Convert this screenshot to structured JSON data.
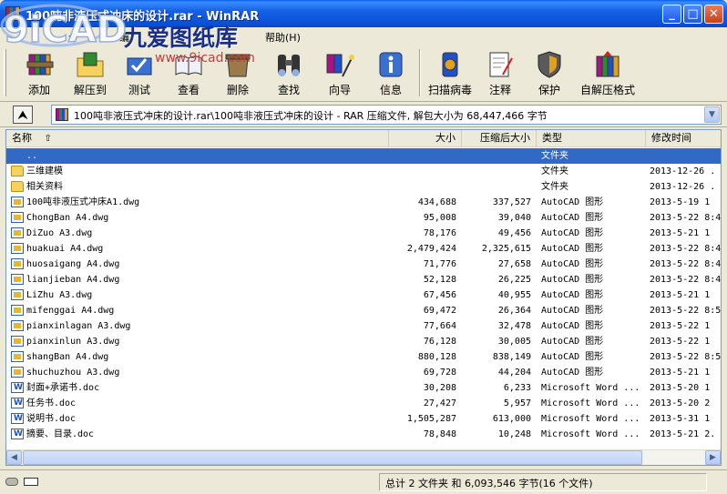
{
  "window": {
    "title": "100吨非液压式冲床的设计.rar - WinRAR",
    "minimize": "_",
    "maximize": "□",
    "close": "✕"
  },
  "menu": {
    "items": [
      "文件(F)",
      "命令(C)",
      "工具(S)",
      "收藏夹(O)",
      "选项(N)",
      "帮助(H)"
    ],
    "visible_items": [
      "令",
      "编",
      "帮助(H)"
    ]
  },
  "toolbar": {
    "buttons": [
      {
        "label": "添加",
        "icon": "add-books-icon"
      },
      {
        "label": "解压到",
        "icon": "extract-folder-icon"
      },
      {
        "label": "测试",
        "icon": "test-icon"
      },
      {
        "label": "查看",
        "icon": "view-book-icon"
      },
      {
        "label": "删除",
        "icon": "delete-icon"
      },
      {
        "label": "查找",
        "icon": "binoculars-icon"
      },
      {
        "label": "向导",
        "icon": "wizard-icon"
      },
      {
        "label": "信息",
        "icon": "info-icon"
      },
      {
        "label": "扫描病毒",
        "icon": "virus-scan-icon"
      },
      {
        "label": "注释",
        "icon": "comment-icon"
      },
      {
        "label": "保护",
        "icon": "shield-icon"
      },
      {
        "label": "自解压格式",
        "icon": "sfx-icon"
      }
    ]
  },
  "address": {
    "path": "100吨非液压式冲床的设计.rar\\100吨非液压式冲床的设计 - RAR 压缩文件, 解包大小为 68,447,466 字节"
  },
  "columns": {
    "name": "名称",
    "size": "大小",
    "packed": "压缩后大小",
    "type": "类型",
    "modified": "修改时间"
  },
  "files": [
    {
      "name": "..",
      "size": "",
      "packed": "",
      "type": "文件夹",
      "modified": "",
      "icon": "up-folder-icon",
      "selected": true
    },
    {
      "name": "三维建模",
      "size": "",
      "packed": "",
      "type": "文件夹",
      "modified": "2013-12-26 .",
      "icon": "folder-icon"
    },
    {
      "name": "相关资料",
      "size": "",
      "packed": "",
      "type": "文件夹",
      "modified": "2013-12-26 .",
      "icon": "folder-icon"
    },
    {
      "name": "100吨非液压式冲床A1.dwg",
      "size": "434,688",
      "packed": "337,527",
      "type": "AutoCAD 图形",
      "modified": "2013-5-19 1",
      "icon": "dwg-file-icon"
    },
    {
      "name": "ChongBan   A4.dwg",
      "size": "95,008",
      "packed": "39,040",
      "type": "AutoCAD 图形",
      "modified": "2013-5-22 8:4",
      "icon": "dwg-file-icon"
    },
    {
      "name": "DiZuo  A3.dwg",
      "size": "78,176",
      "packed": "49,456",
      "type": "AutoCAD 图形",
      "modified": "2013-5-21 1",
      "icon": "dwg-file-icon"
    },
    {
      "name": "huakuai   A4.dwg",
      "size": "2,479,424",
      "packed": "2,325,615",
      "type": "AutoCAD 图形",
      "modified": "2013-5-22 8:4",
      "icon": "dwg-file-icon"
    },
    {
      "name": "huosaigang  A4.dwg",
      "size": "71,776",
      "packed": "27,658",
      "type": "AutoCAD 图形",
      "modified": "2013-5-22 8:4",
      "icon": "dwg-file-icon"
    },
    {
      "name": "lianjieban A4.dwg",
      "size": "52,128",
      "packed": "26,225",
      "type": "AutoCAD 图形",
      "modified": "2013-5-22 8:4",
      "icon": "dwg-file-icon"
    },
    {
      "name": "LiZhu  A3.dwg",
      "size": "67,456",
      "packed": "40,955",
      "type": "AutoCAD 图形",
      "modified": "2013-5-21 1",
      "icon": "dwg-file-icon"
    },
    {
      "name": "mifenggai A4.dwg",
      "size": "69,472",
      "packed": "26,364",
      "type": "AutoCAD 图形",
      "modified": "2013-5-22 8:5",
      "icon": "dwg-file-icon"
    },
    {
      "name": "pianxinlagan  A3.dwg",
      "size": "77,664",
      "packed": "32,478",
      "type": "AutoCAD 图形",
      "modified": "2013-5-22 1",
      "icon": "dwg-file-icon"
    },
    {
      "name": "pianxinlun  A3.dwg",
      "size": "76,128",
      "packed": "30,005",
      "type": "AutoCAD 图形",
      "modified": "2013-5-22 1",
      "icon": "dwg-file-icon"
    },
    {
      "name": "shangBan   A4.dwg",
      "size": "880,128",
      "packed": "838,149",
      "type": "AutoCAD 图形",
      "modified": "2013-5-22 8:5",
      "icon": "dwg-file-icon"
    },
    {
      "name": "shuchuzhou  A3.dwg",
      "size": "69,728",
      "packed": "44,204",
      "type": "AutoCAD 图形",
      "modified": "2013-5-21 1",
      "icon": "dwg-file-icon"
    },
    {
      "name": "封面+承诺书.doc",
      "size": "30,208",
      "packed": "6,233",
      "type": "Microsoft Word ...",
      "modified": "2013-5-20 1",
      "icon": "word-doc-icon"
    },
    {
      "name": "任务书.doc",
      "size": "27,427",
      "packed": "5,957",
      "type": "Microsoft Word ...",
      "modified": "2013-5-20 2",
      "icon": "word-doc-icon"
    },
    {
      "name": "说明书.doc",
      "size": "1,505,287",
      "packed": "613,000",
      "type": "Microsoft Word ...",
      "modified": "2013-5-31 1",
      "icon": "word-doc-icon"
    },
    {
      "name": "摘要、目录.doc",
      "size": "78,848",
      "packed": "10,248",
      "type": "Microsoft Word ...",
      "modified": "2013-5-21 2.",
      "icon": "word-doc-icon"
    }
  ],
  "status": {
    "summary": "总计 2 文件夹 和 6,093,546 字节(16 个文件)"
  },
  "watermark": {
    "logo_text": "9iCAD",
    "brand": "九爱图纸库",
    "url": "www.9icad.com"
  },
  "colors": {
    "title_blue": "#0a5ee8",
    "selection": "#316ac5",
    "chrome": "#ece9d8"
  }
}
